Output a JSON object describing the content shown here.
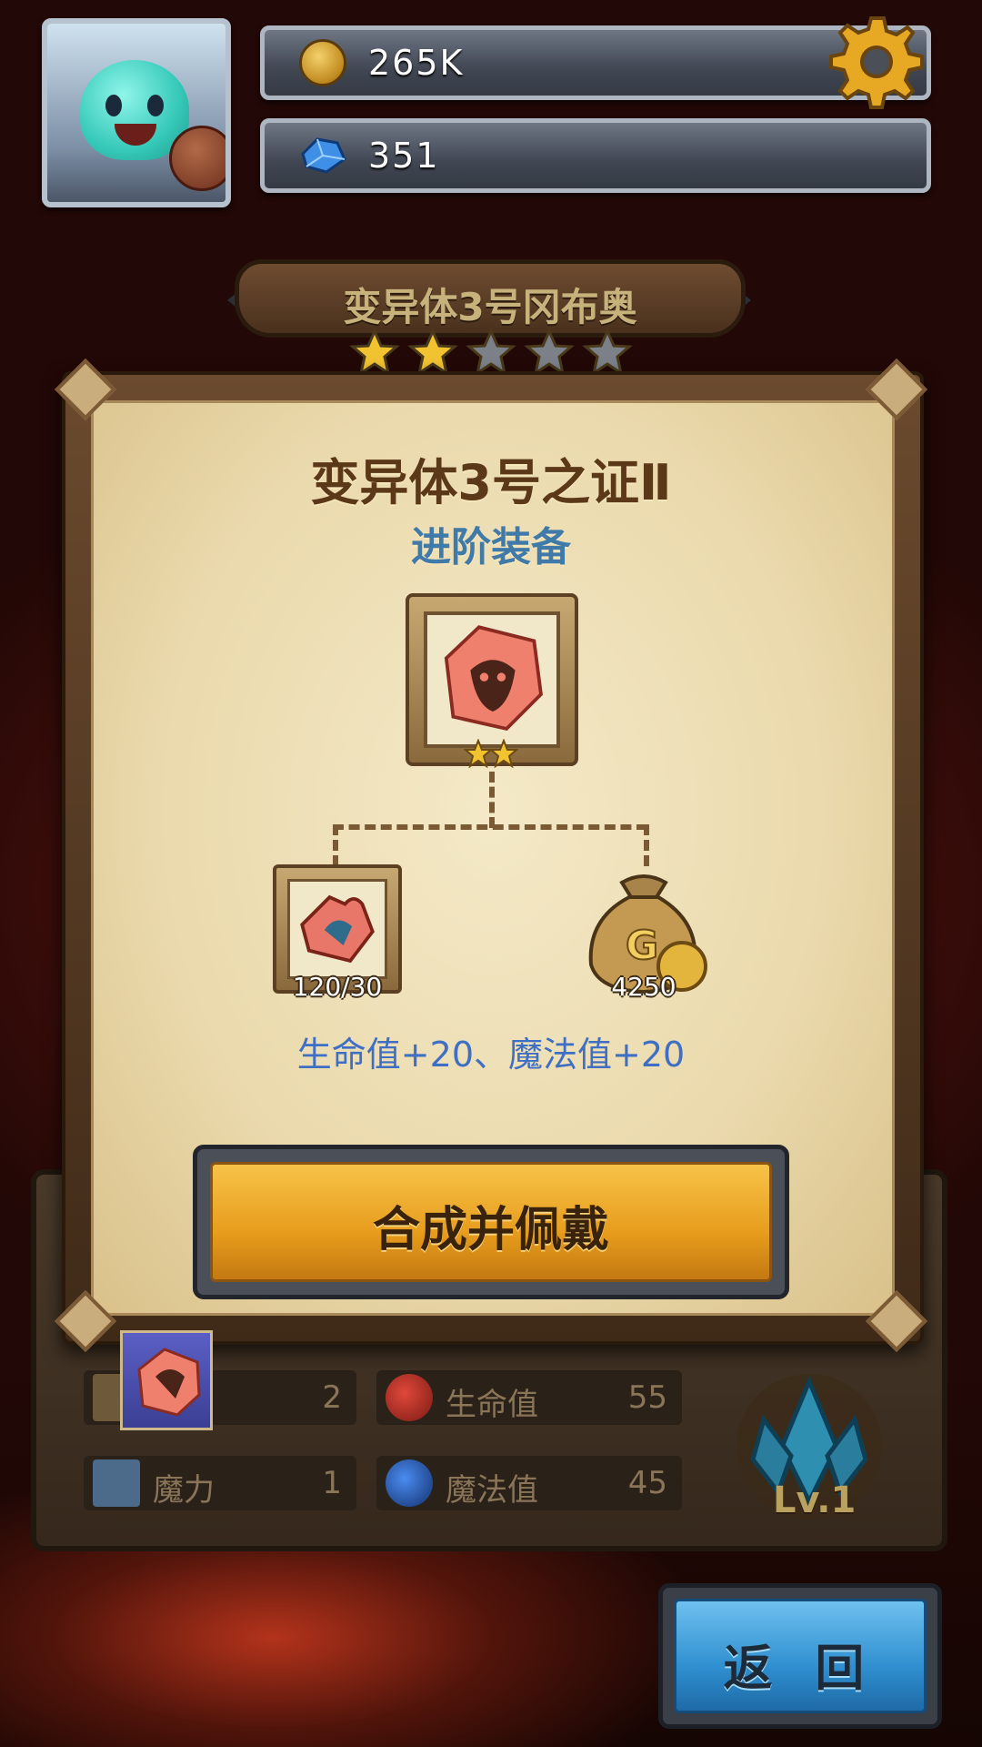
{
  "hud": {
    "gold": "265K",
    "gems": "351",
    "icons": {
      "gold": "gold-coin-icon",
      "gems": "blue-gem-icon",
      "settings": "gear-icon",
      "avatar": "slime-avatar"
    }
  },
  "stage": {
    "title": "变异体3号冈布奥",
    "stars_filled": 2,
    "stars_total": 5
  },
  "dialog": {
    "title": "变异体3号之证Ⅱ",
    "subtitle": "进阶装备",
    "result_item": {
      "icon": "red-emblem-puzzle-icon",
      "stars": 2
    },
    "material": {
      "icon": "puzzle-piece-icon",
      "count": "120/30"
    },
    "gold_cost": {
      "icon": "gold-bag-icon",
      "amount": "4250"
    },
    "bonus_text": "生命值+20、魔法值+20",
    "craft_button": "合成并佩戴"
  },
  "stats": {
    "attack": {
      "label": "",
      "value": "2"
    },
    "hp": {
      "label": "生命值",
      "value": "55"
    },
    "magic_power": {
      "label": "魔力",
      "value": "1"
    },
    "mp": {
      "label": "魔法值",
      "value": "45"
    },
    "level": "Lv.1"
  },
  "back_button": "返 回",
  "colors": {
    "craft_button": "#e9a020",
    "back_button": "#3a9ad8",
    "subtitle": "#3f7aa8",
    "bonus": "#3f6fc4"
  }
}
